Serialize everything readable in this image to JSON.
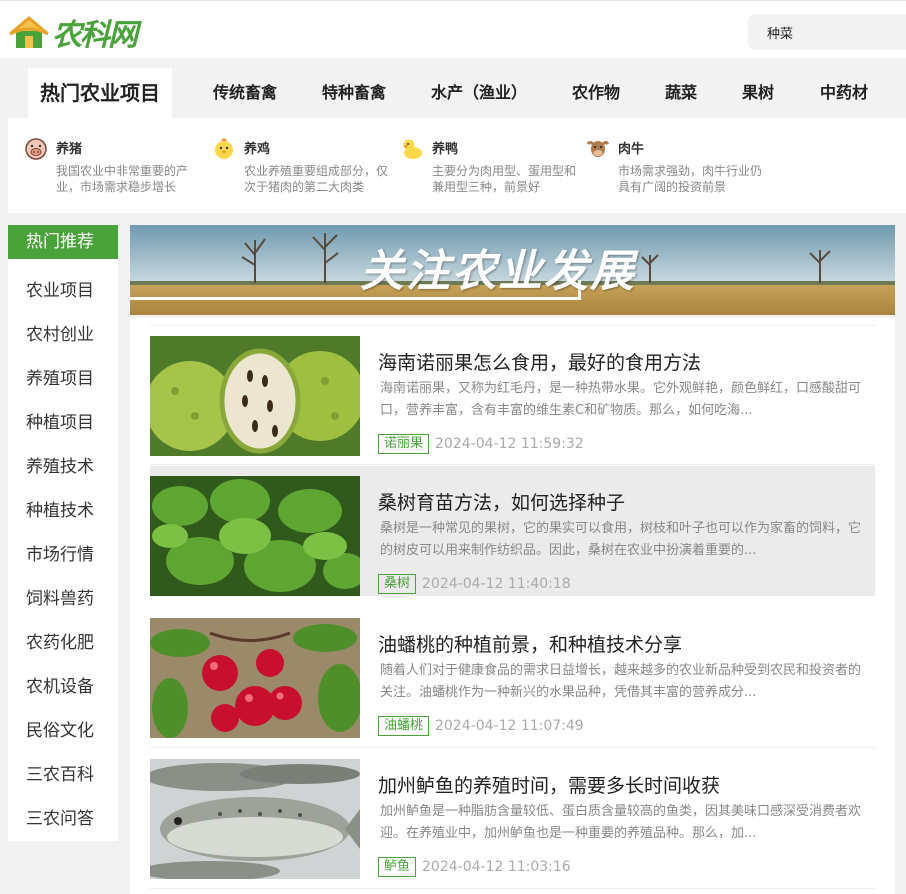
{
  "header": {
    "logo_text": "农科网",
    "search_value": "种菜"
  },
  "nav": {
    "active": "热门农业项目",
    "tabs": [
      "传统畜禽",
      "特种畜禽",
      "水产（渔业）",
      "农作物",
      "蔬菜",
      "果树",
      "中药材"
    ]
  },
  "subcats": [
    {
      "icon": "pig-icon",
      "title": "养猪",
      "desc": "我国农业中非常重要的产业，市场需求稳步增长"
    },
    {
      "icon": "chick-icon",
      "title": "养鸡",
      "desc": "农业养殖重要组成部分，仅次于猪肉的第二大肉类"
    },
    {
      "icon": "duck-icon",
      "title": "养鸭",
      "desc": "主要分为肉用型、蛋用型和兼用型三种，前景好"
    },
    {
      "icon": "cow-icon",
      "title": "肉牛",
      "desc": "市场需求强劲，肉牛行业仍具有广阔的投资前景"
    }
  ],
  "sidebar": {
    "items": [
      "热门推荐",
      "农业项目",
      "农村创业",
      "养殖项目",
      "种植项目",
      "养殖技术",
      "种植技术",
      "市场行情",
      "饲料兽药",
      "农药化肥",
      "农机设备",
      "民俗文化",
      "三农百科",
      "三农问答"
    ]
  },
  "banner": {
    "text": "关注农业发展"
  },
  "articles": [
    {
      "title": "海南诺丽果怎么食用，最好的食用方法",
      "summary": "海南诺丽果，又称为红毛丹，是一种热带水果。它外观鲜艳，颜色鲜红，口感酸甜可口，营养丰富，含有丰富的维生素C和矿物质。那么，如何吃海...",
      "tag": "诺丽果",
      "date": "2024-04-12 11:59:32",
      "image": "noni-fruit"
    },
    {
      "title": "桑树育苗方法，如何选择种子",
      "summary": "桑树是一种常见的果树，它的果实可以食用，树枝和叶子也可以作为家畜的饲料，它的树皮可以用来制作纺织品。因此，桑树在农业中扮演着重要的...",
      "tag": "桑树",
      "date": "2024-04-12 11:40:18",
      "image": "mulberry-leaves"
    },
    {
      "title": "油蟠桃的种植前景，和种植技术分享",
      "summary": "随着人们对于健康食品的需求日益增长，越来越多的农业新品种受到农民和投资者的关注。油蟠桃作为一种新兴的水果品种，凭借其丰富的营养成分...",
      "tag": "油蟠桃",
      "date": "2024-04-12 11:07:49",
      "image": "red-cherries"
    },
    {
      "title": "加州鲈鱼的养殖时间，需要多长时间收获",
      "summary": "加州鲈鱼是一种脂肪含量较低、蛋白质含量较高的鱼类，因其美味口感深受消费者欢迎。在养殖业中，加州鲈鱼也是一种重要的养殖品种。那么，加...",
      "tag": "鲈鱼",
      "date": "2024-04-12 11:03:16",
      "image": "bass-fish"
    }
  ]
}
